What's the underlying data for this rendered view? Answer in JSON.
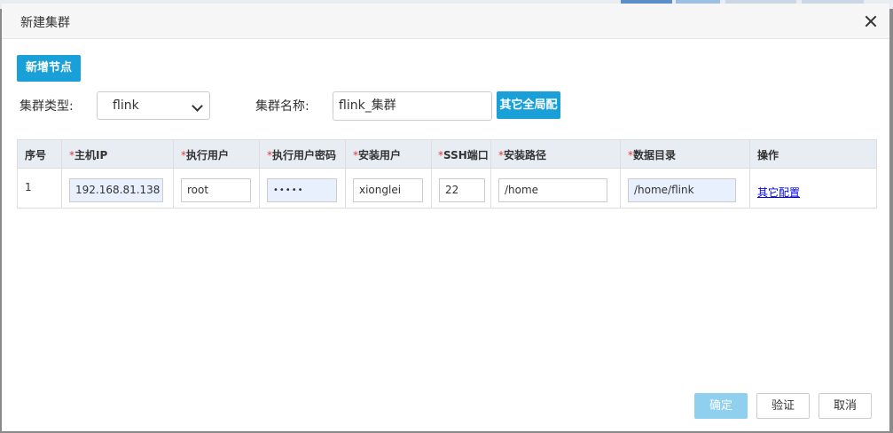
{
  "dialog": {
    "title": "新建集群"
  },
  "toolbar": {
    "add_node_label": "新增节点"
  },
  "form": {
    "cluster_type_label": "集群类型:",
    "cluster_type_value": "flink",
    "cluster_name_label": "集群名称:",
    "cluster_name_value": "flink_集群",
    "global_config_label": "其它全局配"
  },
  "table": {
    "headers": [
      "序号",
      "主机IP",
      "执行用户",
      "执行用户密码",
      "安装用户",
      "SSH端口",
      "安装路径",
      "数据目录",
      "操作"
    ],
    "required_mark": "*",
    "rows": [
      {
        "index": "1",
        "host_ip": "192.168.81.138",
        "exec_user": "root",
        "exec_password_masked": "•••••",
        "install_user": "xionglei",
        "ssh_port": "22",
        "install_path": "/home",
        "data_dir": "/home/flink",
        "action_link": "其它配置"
      }
    ]
  },
  "footer": {
    "confirm_label": "确定",
    "verify_label": "验证",
    "cancel_label": "取消"
  },
  "colors": {
    "primary": "#1aa0d9",
    "primary_disabled": "#8fd0ef",
    "required": "#e53935",
    "header_bg": "#e8edf3"
  }
}
